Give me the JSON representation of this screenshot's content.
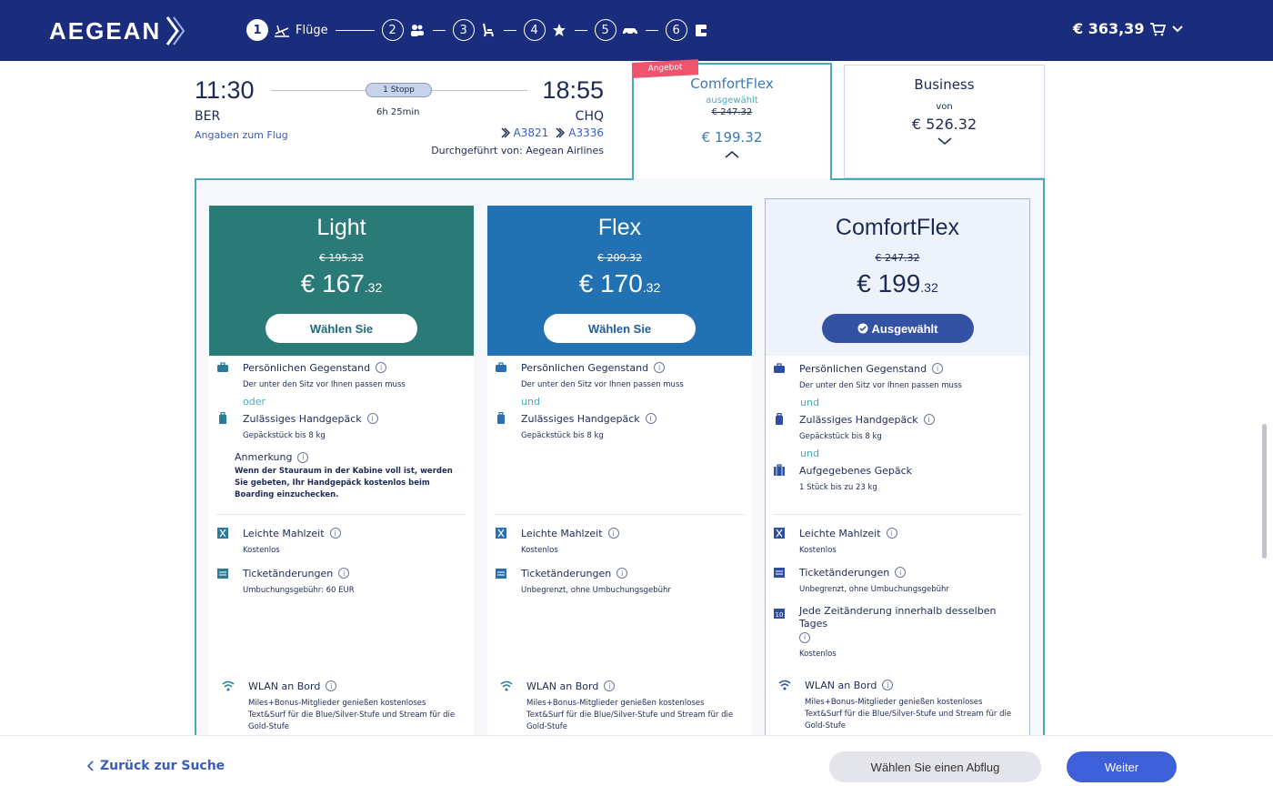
{
  "header": {
    "logo": "AEGEAN",
    "steps": [
      {
        "num": "1",
        "label": "Flüge",
        "icon": "plane-depart-icon"
      },
      {
        "num": "2",
        "icon": "passengers-icon"
      },
      {
        "num": "3",
        "icon": "seat-icon"
      },
      {
        "num": "4",
        "icon": "star-icon"
      },
      {
        "num": "5",
        "icon": "car-icon"
      },
      {
        "num": "6",
        "icon": "wallet-icon"
      }
    ],
    "cart_total": "€ 363,39"
  },
  "flight": {
    "dep_time": "11:30",
    "dep_code": "BER",
    "arr_time": "18:55",
    "arr_code": "CHQ",
    "stops": "1 Stopp",
    "duration": "6h 25min",
    "details_link": "Angaben zum Flug",
    "flight_numbers": [
      "A3821",
      "A3336"
    ],
    "operated_by": "Durchgeführt von: Aegean Airlines"
  },
  "tabs": {
    "ribbon": "Angebot",
    "comfort": {
      "name": "ComfortFlex",
      "status": "ausgewählt",
      "old_price": "€ 247.32",
      "price": "€ 199.32"
    },
    "business": {
      "name": "Business",
      "from": "von",
      "price": "€ 526.32"
    }
  },
  "fares": [
    {
      "name": "Light",
      "old_price": "€ 195.32",
      "price_main": "€ 167",
      "price_cents": ".32",
      "button": "Wählen Sie",
      "item1_title": "Persönlichen Gegenstand",
      "item1_sub": "Der unter den Sitz vor Ihnen passen muss",
      "conj1": "oder",
      "item2_title": "Zulässiges Handgepäck",
      "item2_sub": "Gepäckstück bis 8 kg",
      "note_title": "Anmerkung",
      "note_body": "Wenn der Stauraum in der Kabine voll ist, werden Sie gebeten, Ihr Handgepäck kostenlos beim Boarding einzuchecken.",
      "meal_title": "Leichte Mahlzeit",
      "meal_sub": "Kostenlos",
      "change_title": "Ticketänderungen",
      "change_sub": "Umbuchungsgebühr: 60 EUR",
      "wifi_title": "WLAN an Bord",
      "wifi_sub": "Miles+Bonus-Mitglieder genießen kostenloses Text&Surf für die Blue/Silver-Stufe und Stream für die Gold-Stufe"
    },
    {
      "name": "Flex",
      "old_price": "€ 209.32",
      "price_main": "€ 170",
      "price_cents": ".32",
      "button": "Wählen Sie",
      "item1_title": "Persönlichen Gegenstand",
      "item1_sub": "Der unter den Sitz vor Ihnen passen muss",
      "conj1": "und",
      "item2_title": "Zulässiges Handgepäck",
      "item2_sub": "Gepäckstück bis 8 kg",
      "meal_title": "Leichte Mahlzeit",
      "meal_sub": "Kostenlos",
      "change_title": "Ticketänderungen",
      "change_sub": "Unbegrenzt, ohne Umbuchungsgebühr",
      "wifi_title": "WLAN an Bord",
      "wifi_sub": "Miles+Bonus-Mitglieder genießen kostenloses Text&Surf für die Blue/Silver-Stufe und Stream für die Gold-Stufe"
    },
    {
      "name": "ComfortFlex",
      "old_price": "€ 247.32",
      "price_main": "€ 199",
      "price_cents": ".32",
      "button": "Ausgewählt",
      "item1_title": "Persönlichen Gegenstand",
      "item1_sub": "Der unter den Sitz vor Ihnen passen muss",
      "conj1": "und",
      "item2_title": "Zulässiges Handgepäck",
      "item2_sub": "Gepäckstück bis 8 kg",
      "conj2": "und",
      "item3_title": "Aufgegebenes Gepäck",
      "item3_sub": "1 Stück bis zu 23 kg",
      "meal_title": "Leichte Mahlzeit",
      "meal_sub": "Kostenlos",
      "change_title": "Ticketänderungen",
      "change_sub": "Unbegrenzt, ohne Umbuchungsgebühr",
      "sameday_title": "Jede Zeitänderung innerhalb desselben Tages",
      "sameday_sub": "Kostenlos",
      "sameday_icon_text": "10",
      "wifi_title": "WLAN an Bord",
      "wifi_sub": "Miles+Bonus-Mitglieder genießen kostenloses Text&Surf für die Blue/Silver-Stufe und Stream für die Gold-Stufe"
    }
  ],
  "footer": {
    "back": "Zurück zur Suche",
    "choose": "Wählen Sie einen Abflug",
    "next": "Weiter"
  },
  "info_glyph": "i",
  "colors": {
    "header": "#1a2c7c",
    "light": "#2a7b78",
    "flex": "#2271b3",
    "comfort_bg": "#eef2fa",
    "accent": "#48a9b8",
    "ribbon": "#f0536e",
    "next": "#3d5fd9"
  }
}
